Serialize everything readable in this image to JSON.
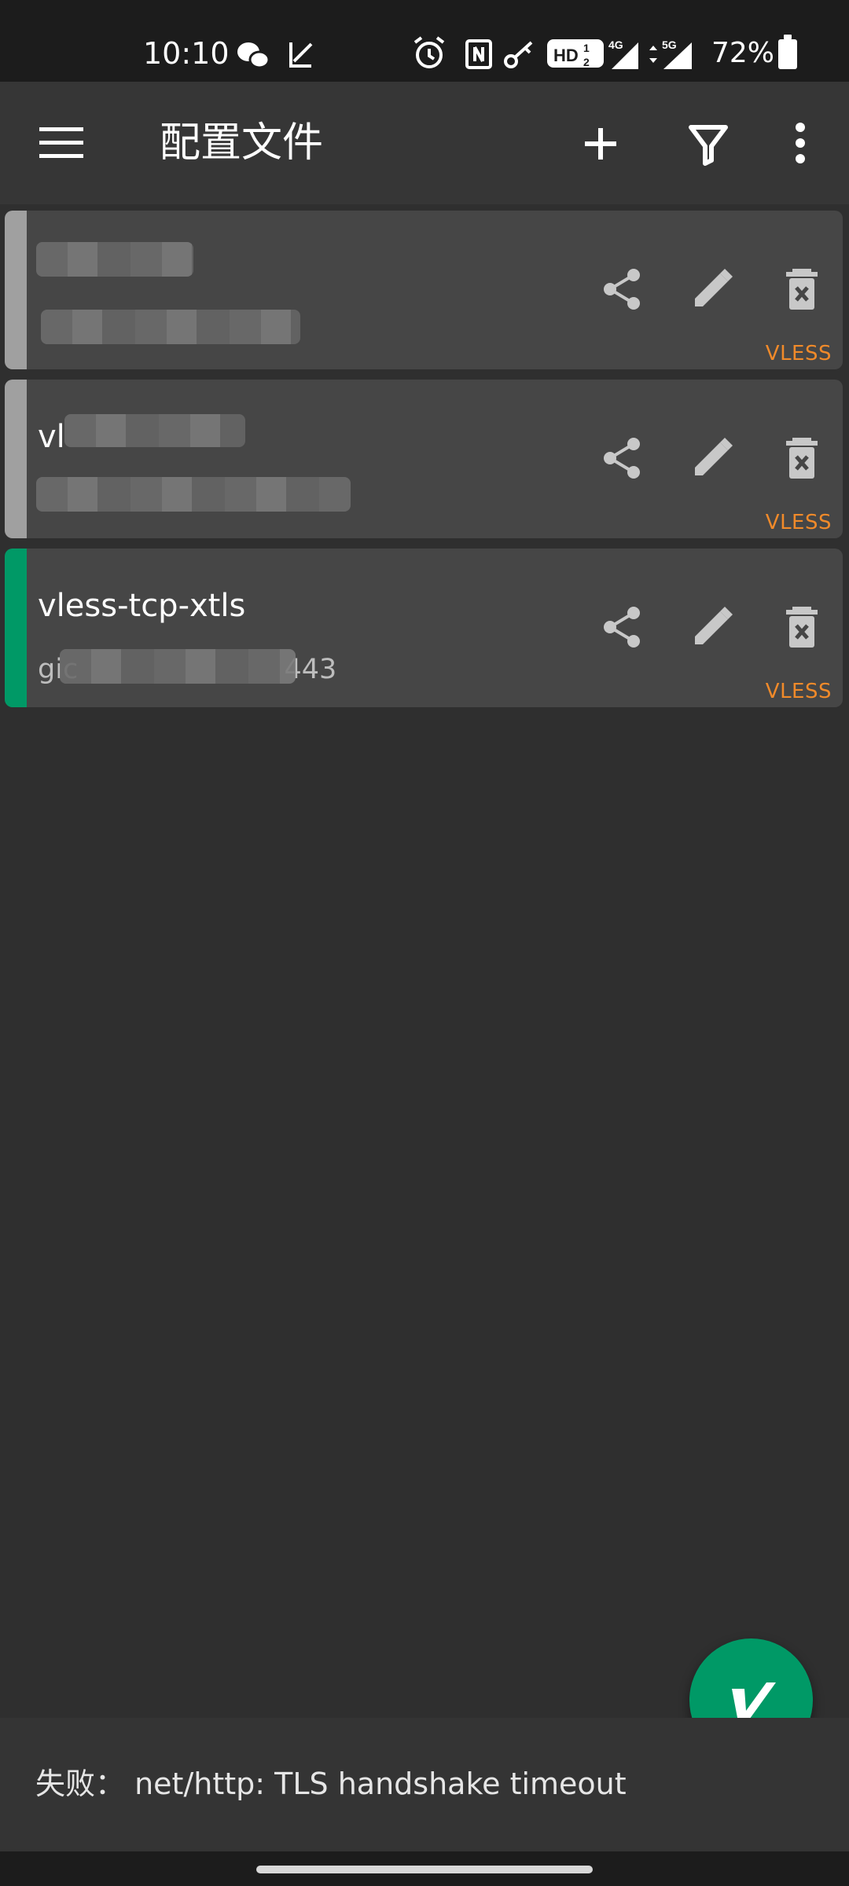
{
  "status_bar": {
    "time": "10:10",
    "battery": "72%",
    "icons": [
      "wechat-icon",
      "vpn-key-icon",
      "alarm-icon",
      "nfc-icon",
      "key-icon",
      "hd-icon",
      "signal-4g-icon",
      "signal-5g-icon",
      "battery-icon"
    ]
  },
  "app_bar": {
    "title": "配置文件",
    "actions": [
      "menu-icon",
      "add-icon",
      "filter-icon",
      "more-vert-icon"
    ]
  },
  "profiles": [
    {
      "name": "",
      "address": "",
      "type": "VLESS",
      "selected": false
    },
    {
      "name": "vl",
      "address": "",
      "type": "VLESS",
      "selected": false
    },
    {
      "name": "vless-tcp-xtls",
      "address": "gic",
      "address_tail": "443",
      "type": "VLESS",
      "selected": true
    }
  ],
  "status_message": "失败： net/http: TLS handshake timeout",
  "colors": {
    "accent": "#009966",
    "type_label": "#f08a2a",
    "inactive_stripe": "#a0a0a0",
    "card": "#464646",
    "background": "#2f2f2f"
  }
}
